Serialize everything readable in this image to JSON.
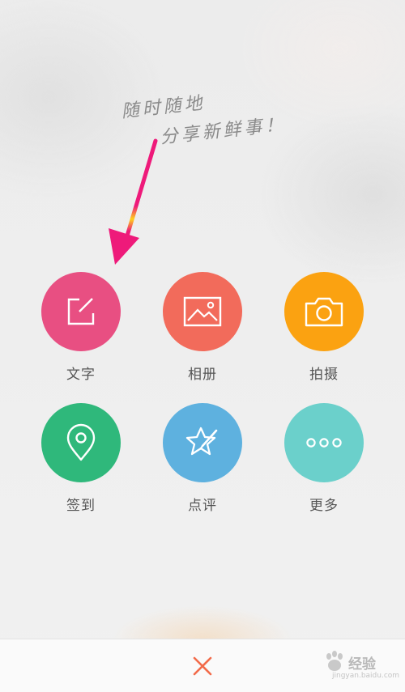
{
  "slogan": {
    "line1": "随时随地",
    "line2": "分享新鲜事！"
  },
  "actions": [
    {
      "id": "text",
      "label": "文字",
      "icon": "edit-icon",
      "color": "#e84f82"
    },
    {
      "id": "album",
      "label": "相册",
      "icon": "image-icon",
      "color": "#f26b5b"
    },
    {
      "id": "camera",
      "label": "拍摄",
      "icon": "camera-icon",
      "color": "#fba211"
    },
    {
      "id": "checkin",
      "label": "签到",
      "icon": "location-pin-icon",
      "color": "#2fb87b"
    },
    {
      "id": "review",
      "label": "点评",
      "icon": "star-pen-icon",
      "color": "#5eb1df"
    },
    {
      "id": "more",
      "label": "更多",
      "icon": "more-dots-icon",
      "color": "#6bd0cb"
    }
  ],
  "close": {
    "icon": "close-icon",
    "color": "#f26b4a"
  },
  "watermark": {
    "text": "经验",
    "url": "jingyan.baidu.com"
  },
  "annotation": {
    "arrow_color": "#ee1a7a"
  }
}
